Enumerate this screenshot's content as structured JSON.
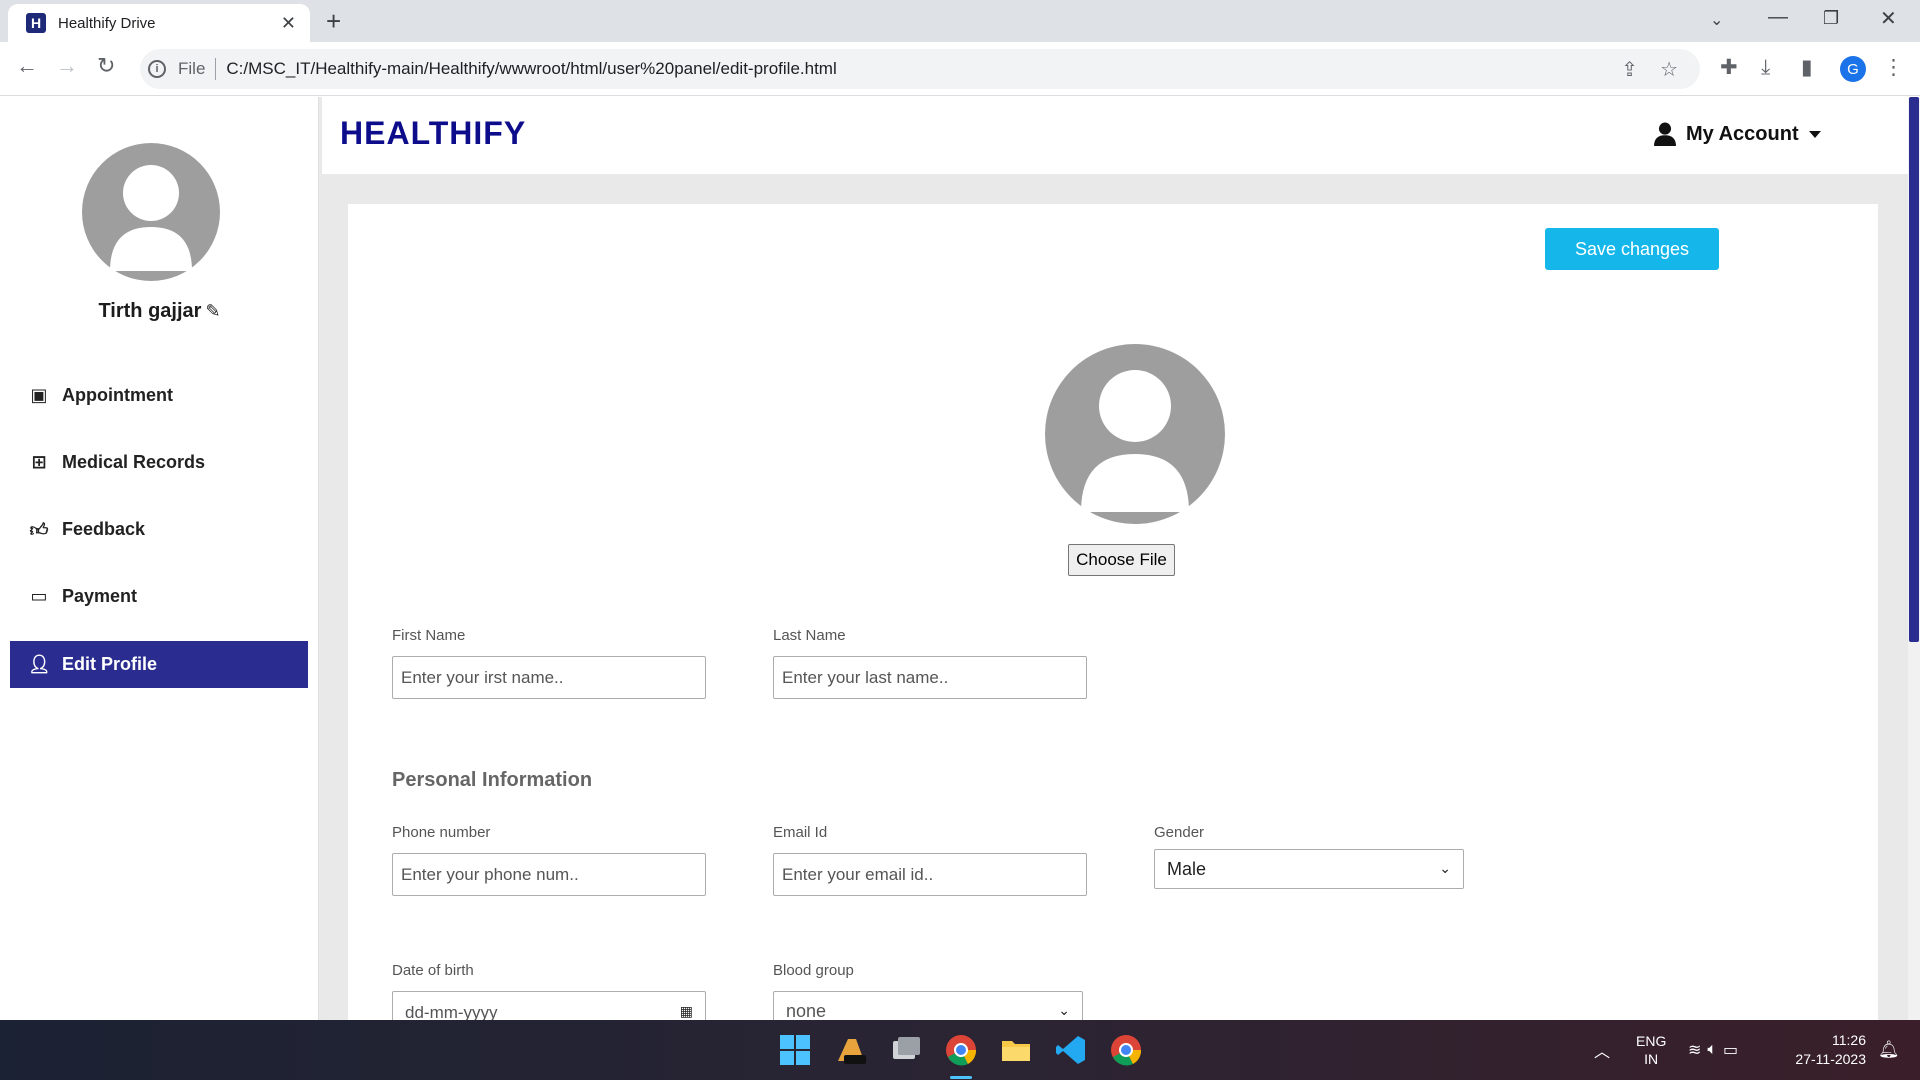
{
  "browser": {
    "tab_title": "Healthify Drive",
    "favicon_letter": "H",
    "scheme": "File",
    "url": "C:/MSC_IT/Healthify-main/Healthify/wwwroot/html/user%20panel/edit-profile.html",
    "profile_initial": "G"
  },
  "sidebar": {
    "user_name": "Tirth gajjar",
    "items": [
      {
        "label": "Appointment",
        "icon": "calendar-check-icon"
      },
      {
        "label": "Medical Records",
        "icon": "medical-file-icon"
      },
      {
        "label": "Feedback",
        "icon": "thumbs-up-icon"
      },
      {
        "label": "Payment",
        "icon": "credit-card-icon"
      },
      {
        "label": "Edit Profile",
        "icon": "user-edit-icon",
        "active": true
      }
    ]
  },
  "header": {
    "brand": "HEALTHIFY",
    "account_label": "My Account"
  },
  "form": {
    "save_label": "Save changes",
    "choose_file_label": "Choose File",
    "first_name": {
      "label": "First Name",
      "placeholder": "Enter your irst name.."
    },
    "last_name": {
      "label": "Last Name",
      "placeholder": "Enter your last name.."
    },
    "section_title": "Personal Information",
    "phone": {
      "label": "Phone number",
      "placeholder": "Enter your phone num.."
    },
    "email": {
      "label": "Email Id",
      "placeholder": "Enter your email id.."
    },
    "gender": {
      "label": "Gender",
      "value": "Male"
    },
    "dob": {
      "label": "Date of birth",
      "placeholder": "dd-mm-yyyy"
    },
    "blood_group": {
      "label": "Blood group",
      "value": "none"
    }
  },
  "taskbar": {
    "lang_line1": "ENG",
    "lang_line2": "IN",
    "time": "11:26",
    "date": "27-11-2023"
  },
  "colors": {
    "brand": "#0d0d8c",
    "active_nav": "#2a2d8f",
    "save_button": "#15b7ea",
    "avatar_gray": "#9e9e9e"
  }
}
